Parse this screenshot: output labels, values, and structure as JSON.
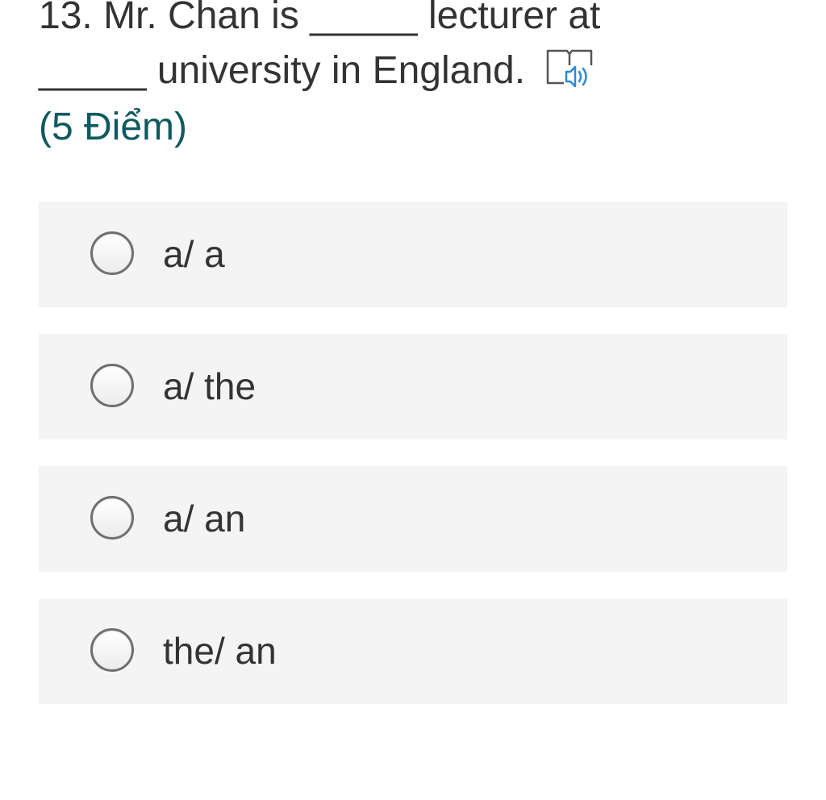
{
  "question": {
    "line1": "13. Mr. Chan is _____ lecturer at",
    "line2": "_____ university in England.",
    "points": "(5 Điểm)",
    "reader_icon": "immersive-reader-icon",
    "accent_color": "#0f5a5f",
    "reader_icon_color": "#2b88d8"
  },
  "options": [
    {
      "label": "a/ a",
      "selected": false
    },
    {
      "label": "a/ the",
      "selected": false
    },
    {
      "label": "a/ an",
      "selected": false
    },
    {
      "label": "the/ an",
      "selected": false
    }
  ]
}
